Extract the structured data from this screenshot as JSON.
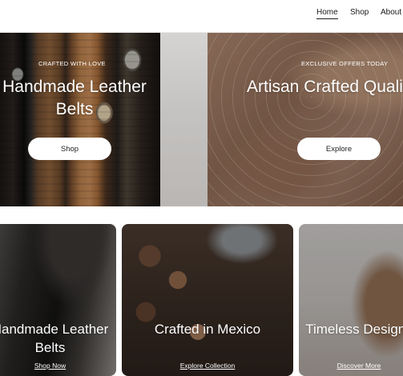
{
  "nav": {
    "items": [
      {
        "label": "Home",
        "active": true
      },
      {
        "label": "Shop",
        "active": false
      },
      {
        "label": "About",
        "active": false
      }
    ]
  },
  "hero": {
    "left": {
      "eyebrow": "CRAFTED WITH LOVE",
      "title_line1": "Handmade Leather",
      "title_line2": "Belts",
      "button": "Shop"
    },
    "right": {
      "eyebrow": "EXCLUSIVE OFFERS TODAY",
      "title": "Artisan Crafted Quality",
      "button": "Explore"
    }
  },
  "cards": [
    {
      "title_line1": "Handmade Leather",
      "title_line2": "Belts",
      "link": "Shop Now"
    },
    {
      "title_line1": "Crafted in Mexico",
      "title_line2": "",
      "link": "Explore Collection"
    },
    {
      "title_line1": "Timeless Designs",
      "title_line2": "",
      "link": "Discover More"
    }
  ]
}
